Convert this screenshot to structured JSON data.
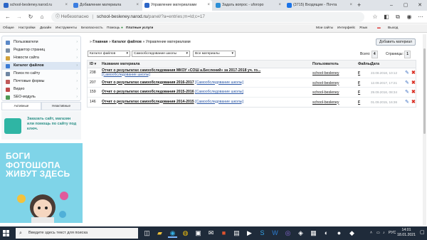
{
  "browser": {
    "tabs": [
      {
        "label": "school-besleney.narod.ru",
        "active": false,
        "fav_color": "#2c66c7"
      },
      {
        "label": "Добавление материала",
        "active": false,
        "fav_color": "#3b7de0"
      },
      {
        "label": "Управление материалами",
        "active": true,
        "fav_color": "#2c66c7"
      },
      {
        "label": "Задать вопрос - uforopo",
        "active": false,
        "fav_color": "#2c8fd6"
      },
      {
        "label": "(3715) Входящие - Почта",
        "active": false,
        "fav_color": "#1a73e8"
      }
    ],
    "new_tab": "+",
    "address": {
      "warning": "Небезопасно",
      "separator": "|",
      "host": "school-besleney.narod.ru",
      "path": "/panel/?a=entries;m=ld;c=17"
    }
  },
  "ucoz_bar": {
    "left": [
      "Общие",
      "Настройки",
      "Дизайн",
      "Инструменты",
      "Безопасность",
      "Помощь",
      "Платные услуги"
    ],
    "right": [
      "Мои сайты",
      "Интерфейс",
      "Язык",
      "Выход"
    ]
  },
  "sidebar": {
    "items": [
      {
        "label": "Пользователи",
        "color": "#5a88c8"
      },
      {
        "label": "Редактор страниц",
        "color": "#7a8ea6"
      },
      {
        "label": "Новости сайта",
        "color": "#d2a13a"
      },
      {
        "label": "Каталог файлов",
        "color": "#3a7bd5",
        "active": true
      },
      {
        "label": "Поиск по сайту",
        "color": "#6f86a3"
      },
      {
        "label": "Почтовые формы",
        "color": "#c05a5a"
      },
      {
        "label": "Видео",
        "color": "#c04b4b"
      },
      {
        "label": "SEO-модуль",
        "color": "#4f9a55"
      }
    ],
    "tabs": [
      "Активные",
      "Неактивные"
    ],
    "promo": {
      "text": "Заказать сайт, магазин или помощь по сайту под ключ."
    },
    "promo2": {
      "text": "БОГИ ФОТОШОПА ЖИВУТ ЗДЕСЬ"
    }
  },
  "main": {
    "breadcrumb": {
      "home": "Главная",
      "sep": "»",
      "section": "Каталог файлов",
      "current": "Управление материалами"
    },
    "add_button": "Добавить материал",
    "filters": [
      "Каталог файлов",
      "Самообследование школы",
      "Все материалы"
    ],
    "total_label": "Всего:",
    "total_value": "4",
    "pages_label": "Страницы:",
    "pages_value": "1",
    "columns": {
      "id": "ID",
      "name": "Название материала",
      "user": "Пользователь",
      "files": "Файлы",
      "date": "Дата"
    },
    "rows": [
      {
        "id": "238",
        "title": "Отчет о результатах самообследования МКОУ «СОШ а.Беслений» за 2017-2018 уч. го...",
        "category": "[Самообследование школы]",
        "user": "school-besleney",
        "files": "F",
        "date": "23.08.2018, 10:12"
      },
      {
        "id": "207",
        "title": "Отчет о результатах самообследования 2016-2017",
        "category": "[Самообследование школы]",
        "user": "school-besleney",
        "files": "F",
        "date": "12.09.2017, 17:21"
      },
      {
        "id": "159",
        "title": "Отчет о результатах самообследования 2015-2016",
        "category": "[Самообследование школы]",
        "user": "school-besleney",
        "files": "F",
        "date": "29.09.2016, 08:34"
      },
      {
        "id": "146",
        "title": "Отчет о результатах самообследования 2014-2015",
        "category": "[Самообследование школы]",
        "user": "school-besleney",
        "files": "F",
        "date": "01.09.2015, 16:36"
      }
    ]
  },
  "taskbar": {
    "search_placeholder": "Введите здесь текст для поиска",
    "lang": "РУС",
    "time": "14:01",
    "date": "18.01.2021"
  }
}
